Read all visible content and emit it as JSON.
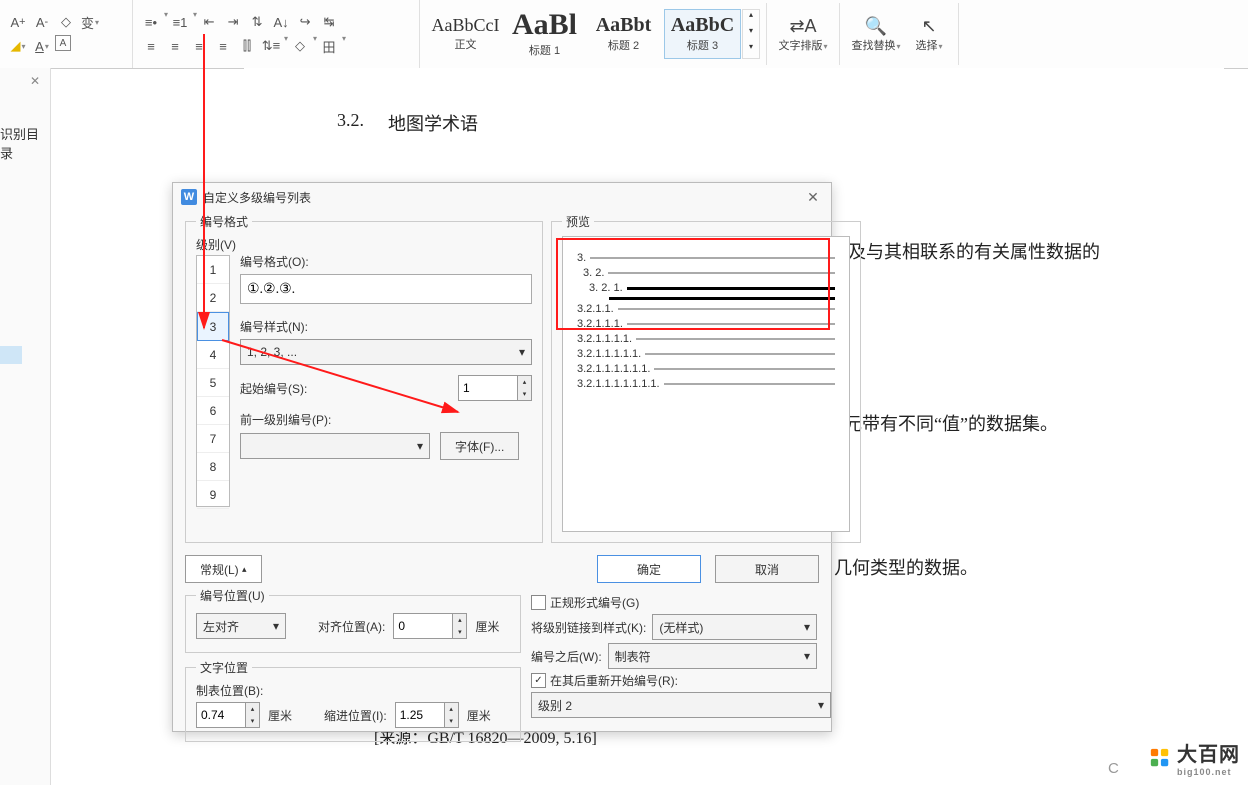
{
  "ribbon": {
    "bullets_icon": "≡•",
    "numbering_icon": "≡1",
    "dec_indent": "⇤",
    "inc_indent": "⇥",
    "line_sp": "↕",
    "tab_icon": "↹",
    "align_l": "≡",
    "align_c": "≡",
    "align_r": "≡",
    "align_j": "≡",
    "fill_icon": "◇",
    "border_icon": "田",
    "styles": [
      {
        "preview": "AaBbCcI",
        "label": "正文"
      },
      {
        "preview": "AaBl",
        "label": "标题 1"
      },
      {
        "preview": "AaBbt",
        "label": "标题 2"
      },
      {
        "preview": "AaBbC",
        "label": "标题 3"
      }
    ],
    "layout": "文字排版",
    "find": "查找替换",
    "select": "选择",
    "layout_icon": "⇄A",
    "find_icon": "🔍",
    "select_icon": "↖"
  },
  "sidebar": {
    "close": "✕",
    "title": "识别目录"
  },
  "doc": {
    "heading_num": "3.2.",
    "heading": "地图学术语",
    "line1_tail": "据及与其相联系的有关属性数据的",
    "line2_tail": "单元带有不同“值”的数据集。",
    "line3_tail": "几何类型的数据。",
    "source": "[来源：GB/T 16820—2009, 5.16]"
  },
  "dialog": {
    "title": "自定义多级编号列表",
    "close": "✕",
    "fs_format": "编号格式",
    "fs_preview": "预览",
    "level_lbl": "级别(V)",
    "levels": [
      "1",
      "2",
      "3",
      "4",
      "5",
      "6",
      "7",
      "8",
      "9"
    ],
    "level_sel": 2,
    "numfmt_lbl": "编号格式(O):",
    "numfmt_val": "①.②.③.",
    "numstyle_lbl": "编号样式(N):",
    "numstyle_val": "1, 2, 3, ...",
    "start_lbl": "起始编号(S):",
    "start_val": "1",
    "prevlvl_lbl": "前一级别编号(P):",
    "prevlvl_val": "",
    "font_btn": "字体(F)...",
    "adv_btn": "常规(L)",
    "ok": "确定",
    "cancel": "取消",
    "pos_legend": "编号位置(U)",
    "align_val": "左对齐",
    "alignpos_lbl": "对齐位置(A):",
    "alignpos_val": "0",
    "unit": "厘米",
    "txt_legend": "文字位置",
    "tabpos_lbl": "制表位置(B):",
    "tabpos_val": "0.74",
    "indent_lbl": "缩进位置(I):",
    "indent_val": "1.25",
    "legal_chk": false,
    "legal_lbl": "正规形式编号(G)",
    "link_lbl": "将级别链接到样式(K):",
    "link_val": "(无样式)",
    "after_lbl": "编号之后(W):",
    "after_val": "制表符",
    "restart_chk": true,
    "restart_lbl": "在其后重新开始编号(R):",
    "restart_val": "级别 2",
    "preview_lines": [
      "3.",
      "3. 2.",
      "3. 2. 1.",
      "",
      "3.2.1.1.",
      "3.2.1.1.1.",
      "3.2.1.1.1.1.",
      "3.2.1.1.1.1.1.",
      "3.2.1.1.1.1.1.1.",
      "3.2.1.1.1.1.1.1.1."
    ]
  },
  "watermark": {
    "text": "大百网",
    "sub": "big100.net"
  }
}
